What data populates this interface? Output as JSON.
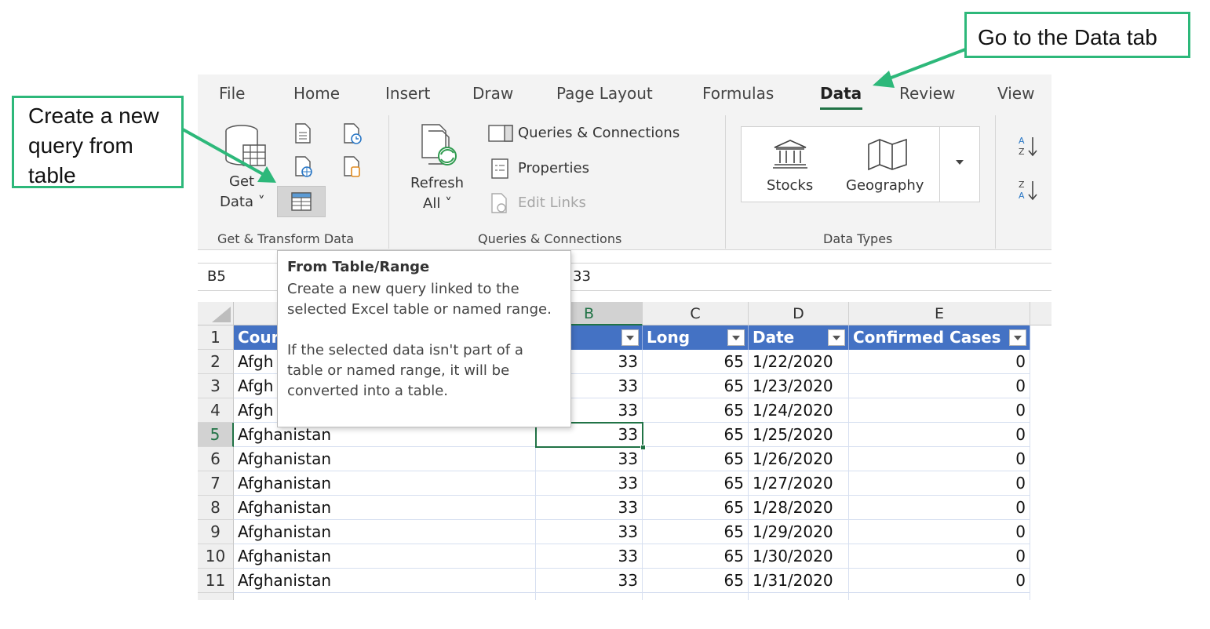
{
  "callouts": {
    "data_tab": "Go to the Data tab",
    "new_query": "Create a new query from table",
    "accent": "#2db87a"
  },
  "tabs": [
    "File",
    "Home",
    "Insert",
    "Draw",
    "Page Layout",
    "Formulas",
    "Data",
    "Review",
    "View"
  ],
  "active_tab": "Data",
  "ribbon": {
    "get_transform": {
      "get_data_label": "Get Data",
      "get_data_line1": "Get",
      "get_data_line2": "Data ˅",
      "group_label": "Get & Transform Data"
    },
    "queries": {
      "refresh_line1": "Refresh",
      "refresh_line2": "All ˅",
      "queries_connections": "Queries & Connections",
      "properties": "Properties",
      "edit_links": "Edit Links",
      "group_label": "Queries & Connections"
    },
    "data_types": {
      "stocks": "Stocks",
      "geography": "Geography",
      "group_label": "Data Types"
    }
  },
  "formula_bar": {
    "name_box": "B5",
    "value": "33"
  },
  "tooltip": {
    "title": "From Table/Range",
    "body1": "Create a new query linked to the selected Excel table or named range.",
    "body2": "If the selected data isn't part of a table or named range, it will be converted into a table."
  },
  "grid": {
    "columns": [
      "B",
      "C",
      "D",
      "E"
    ],
    "headers": [
      "Cour",
      "",
      "Long",
      "Date",
      "Confirmed Cases"
    ],
    "selected_cell": "B5",
    "rows": [
      {
        "n": "1"
      },
      {
        "n": "2",
        "country": "Afgh",
        "lat": "33",
        "long": "65",
        "date": "1/22/2020",
        "cases": "0"
      },
      {
        "n": "3",
        "country": "Afgh",
        "lat": "33",
        "long": "65",
        "date": "1/23/2020",
        "cases": "0"
      },
      {
        "n": "4",
        "country": "Afgh",
        "lat": "33",
        "long": "65",
        "date": "1/24/2020",
        "cases": "0"
      },
      {
        "n": "5",
        "country": "Afghanistan",
        "lat": "33",
        "long": "65",
        "date": "1/25/2020",
        "cases": "0"
      },
      {
        "n": "6",
        "country": "Afghanistan",
        "lat": "33",
        "long": "65",
        "date": "1/26/2020",
        "cases": "0"
      },
      {
        "n": "7",
        "country": "Afghanistan",
        "lat": "33",
        "long": "65",
        "date": "1/27/2020",
        "cases": "0"
      },
      {
        "n": "8",
        "country": "Afghanistan",
        "lat": "33",
        "long": "65",
        "date": "1/28/2020",
        "cases": "0"
      },
      {
        "n": "9",
        "country": "Afghanistan",
        "lat": "33",
        "long": "65",
        "date": "1/29/2020",
        "cases": "0"
      },
      {
        "n": "10",
        "country": "Afghanistan",
        "lat": "33",
        "long": "65",
        "date": "1/30/2020",
        "cases": "0"
      },
      {
        "n": "11",
        "country": "Afghanistan",
        "lat": "33",
        "long": "65",
        "date": "1/31/2020",
        "cases": "0"
      }
    ]
  }
}
